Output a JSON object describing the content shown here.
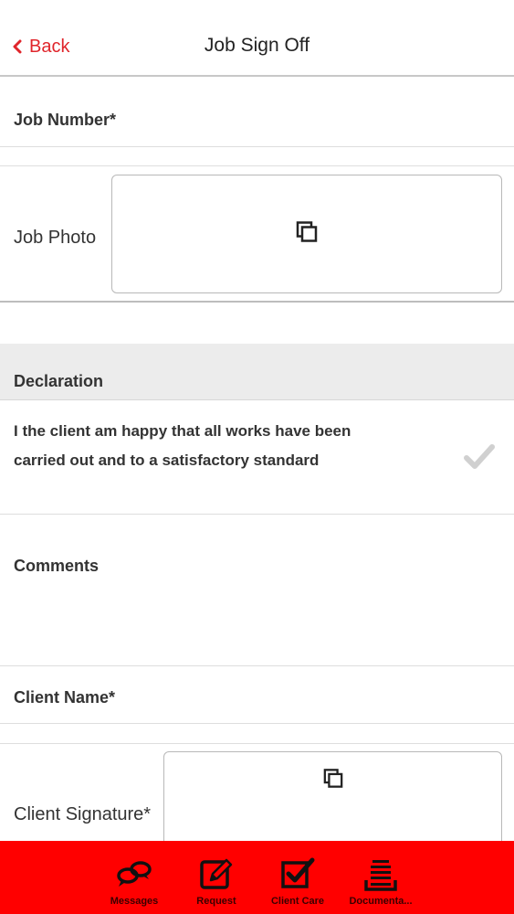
{
  "nav": {
    "back_label": "Back",
    "title": "Job Sign Off"
  },
  "form": {
    "job_number_label": "Job Number*",
    "job_photo_label": "Job Photo",
    "declaration_header": "Declaration",
    "declaration_text": "I the client am happy that all works have been carried out and to a satisfactory standard",
    "declaration_checked": false,
    "comments_label": "Comments",
    "client_name_label": "Client Name*",
    "client_signature_label": "Client Signature*"
  },
  "tabbar": {
    "tabs": [
      {
        "label": "Messages",
        "icon": "messages-icon"
      },
      {
        "label": "Request",
        "icon": "request-icon"
      },
      {
        "label": "Client Care",
        "icon": "client-care-icon"
      },
      {
        "label": "Documenta...",
        "icon": "documents-icon"
      }
    ]
  },
  "colors": {
    "accent": "#e0252b",
    "tabbar_bg": "#ff0000",
    "section_header_bg": "#ececec"
  }
}
